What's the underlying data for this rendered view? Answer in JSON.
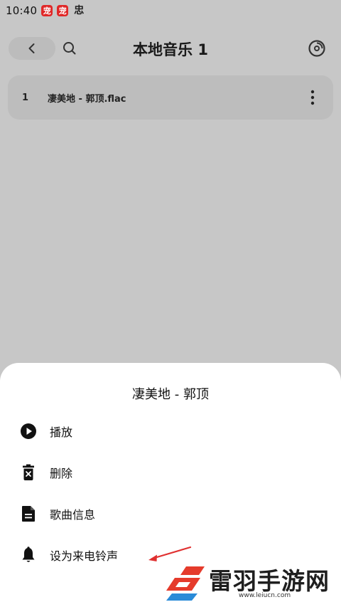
{
  "status_bar": {
    "time": "10:40",
    "notif_glyph_1": "宠",
    "notif_glyph_2": "宠",
    "notif_glyph_3": "忠"
  },
  "header": {
    "back_icon": "chevron-left-icon",
    "search_icon": "search-icon",
    "title": "本地音乐 1",
    "disc_icon": "music-disc-icon"
  },
  "tracks": [
    {
      "index": "1",
      "title": "凄美地 - 郭顶.flac",
      "more_icon": "more-vertical-icon"
    }
  ],
  "sheet": {
    "title": "凄美地 - 郭顶",
    "items": [
      {
        "label": "播放",
        "icon": "play-circle-icon"
      },
      {
        "label": "删除",
        "icon": "trash-icon"
      },
      {
        "label": "歌曲信息",
        "icon": "document-icon"
      },
      {
        "label": "设为来电铃声",
        "icon": "bell-icon"
      }
    ]
  },
  "annotation": {
    "color": "#e03030"
  },
  "watermark": {
    "text": "雷羽手游网",
    "url": "www.leiucn.com"
  },
  "colors": {
    "dim_background": "#c7c7c7",
    "sheet": "#ffffff",
    "accent_red": "#e02828"
  }
}
